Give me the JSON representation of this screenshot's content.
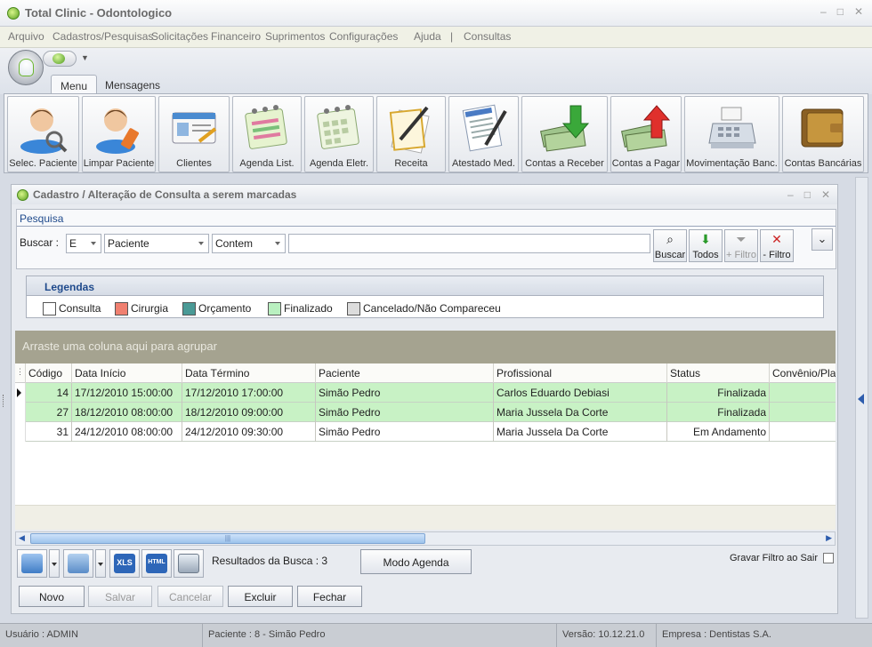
{
  "window": {
    "title": "Total Clinic - Odontologico",
    "controls": [
      "–",
      "□",
      "✕"
    ]
  },
  "menu": [
    "Arquivo",
    "Cadastros/Pesquisas",
    "Solicitações",
    "Financeiro",
    "Suprimentos",
    "Configurações",
    "Ajuda",
    "|",
    "Consultas"
  ],
  "ribbon_tabs": [
    "Menu",
    "Mensagens"
  ],
  "ribbon_buttons": [
    {
      "label": "Selec. Paciente",
      "icon": "patient-search-icon"
    },
    {
      "label": "Limpar Paciente",
      "icon": "patient-eraser-icon"
    },
    {
      "label": "Clientes",
      "icon": "client-card-icon"
    },
    {
      "label": "Agenda List.",
      "icon": "agenda-list-icon"
    },
    {
      "label": "Agenda Eletr.",
      "icon": "agenda-calendar-icon"
    },
    {
      "label": "Receita",
      "icon": "prescription-pen-icon"
    },
    {
      "label": "Atestado Med.",
      "icon": "medical-certificate-icon"
    },
    {
      "label": "Contas a Receber",
      "icon": "money-in-icon"
    },
    {
      "label": "Contas a Pagar",
      "icon": "money-out-icon"
    },
    {
      "label": "Movimentação Banc.",
      "icon": "cash-register-icon"
    },
    {
      "label": "Contas Bancárias",
      "icon": "wallet-icon"
    }
  ],
  "child_window": {
    "title": "Cadastro / Alteração de Consulta a serem marcadas",
    "controls": [
      "–",
      "□",
      "✕"
    ]
  },
  "search": {
    "group_label": "Pesquisa",
    "buscar_label": "Buscar :",
    "operator": "E",
    "field": "Paciente",
    "condition": "Contem",
    "value": "",
    "buttons": {
      "buscar": "Buscar",
      "todos": "Todos",
      "add_filtro": "+ Filtro",
      "remove_filtro": "- Filtro"
    },
    "expand_glyph": "⌄"
  },
  "legend": {
    "title": "Legendas",
    "items": [
      {
        "label": "Consulta",
        "color": "#ffffff"
      },
      {
        "label": "Cirurgia",
        "color": "#f08070"
      },
      {
        "label": "Orçamento",
        "color": "#4a9a96"
      },
      {
        "label": "Finalizado",
        "color": "#b9f0c0"
      },
      {
        "label": "Cancelado/Não Compareceu",
        "color": "#dcdcdc"
      }
    ]
  },
  "grid": {
    "group_hint": "Arraste uma coluna aqui para agrupar",
    "columns": [
      "Código",
      "Data Início",
      "Data Término",
      "Paciente",
      "Profissional",
      "Status",
      "Convênio/Pla"
    ],
    "rows": [
      {
        "codigo": "14",
        "inicio": "17/12/2010 15:00:00",
        "termino": "17/12/2010 17:00:00",
        "paciente": "Simão Pedro",
        "profissional": "Carlos Eduardo Debiasi",
        "status": "Finalizada",
        "convenio": "",
        "color": "#c8f2c5"
      },
      {
        "codigo": "27",
        "inicio": "18/12/2010 08:00:00",
        "termino": "18/12/2010 09:00:00",
        "paciente": "Simão Pedro",
        "profissional": "Maria Jussela Da Corte",
        "status": "Finalizada",
        "convenio": "",
        "color": "#c8f2c5"
      },
      {
        "codigo": "31",
        "inicio": "24/12/2010 08:00:00",
        "termino": "24/12/2010 09:30:00",
        "paciente": "Simão Pedro",
        "profissional": "Maria Jussela Da Corte",
        "status": "Em Andamento",
        "convenio": "",
        "color": "#ffffff"
      }
    ],
    "scroll_grip": "|||"
  },
  "toolbar": {
    "results_label": "Resultados da Busca : 3",
    "modo_agenda": "Modo Agenda",
    "gravar_filtro": "Gravar Filtro ao Sair",
    "export_xls": "XLS",
    "export_html": "HTML"
  },
  "actions": {
    "novo": "Novo",
    "salvar": "Salvar",
    "cancelar": "Cancelar",
    "excluir": "Excluir",
    "fechar": "Fechar"
  },
  "status_bar": {
    "usuario": "Usuário : ADMIN",
    "paciente": "Paciente : 8 - Simão Pedro",
    "versao": "Versão: 10.12.21.0",
    "empresa": "Empresa : Dentistas S.A."
  }
}
